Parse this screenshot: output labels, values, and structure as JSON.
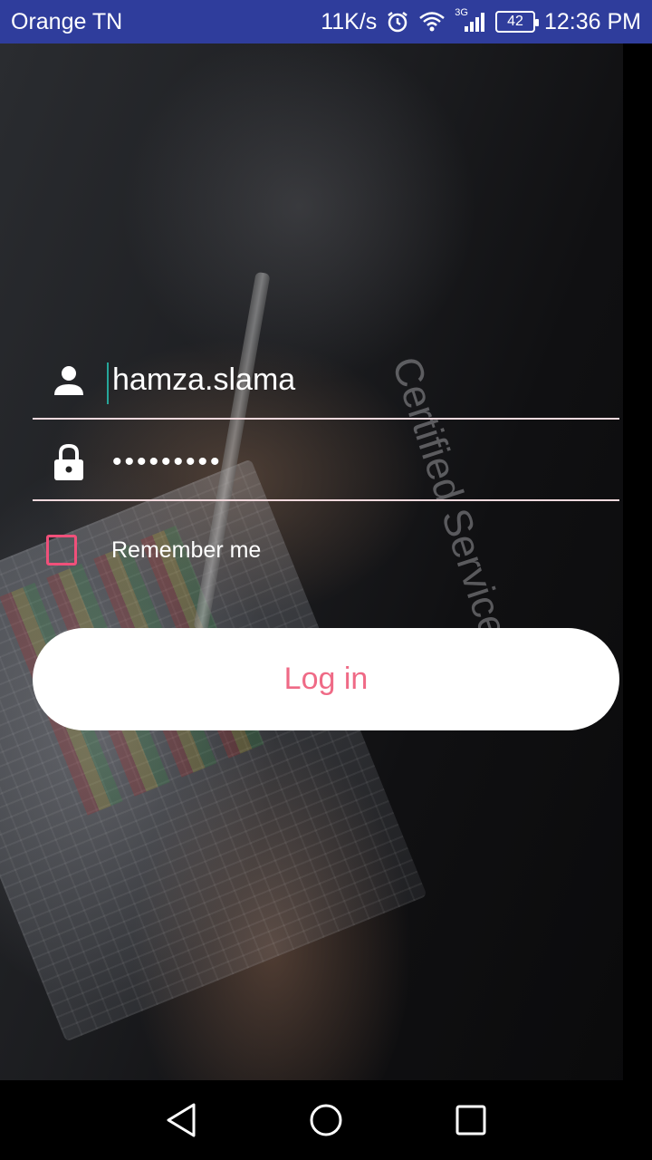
{
  "status_bar": {
    "carrier": "Orange TN",
    "net_speed": "11K/s",
    "network_type": "3G",
    "battery": "42",
    "time": "12:36 PM",
    "icons": [
      "alarm-icon",
      "wifi-icon",
      "signal-icon",
      "battery-icon"
    ]
  },
  "background": {
    "shirt_text": "Certified Service"
  },
  "login_form": {
    "username": {
      "icon": "person-icon",
      "value": "hamza.slama"
    },
    "password": {
      "icon": "lock-icon",
      "value": "•••••••••"
    },
    "remember_me": {
      "label": "Remember me",
      "checked": false
    },
    "login_button": {
      "label": "Log in"
    }
  },
  "nav_bar": {
    "icons": [
      "back-icon",
      "home-icon",
      "recents-icon"
    ]
  },
  "colors": {
    "status_bar": "#2f3d9c",
    "accent": "#ef6a86",
    "checkbox_border": "#f0507a",
    "cursor": "#26a69a"
  }
}
